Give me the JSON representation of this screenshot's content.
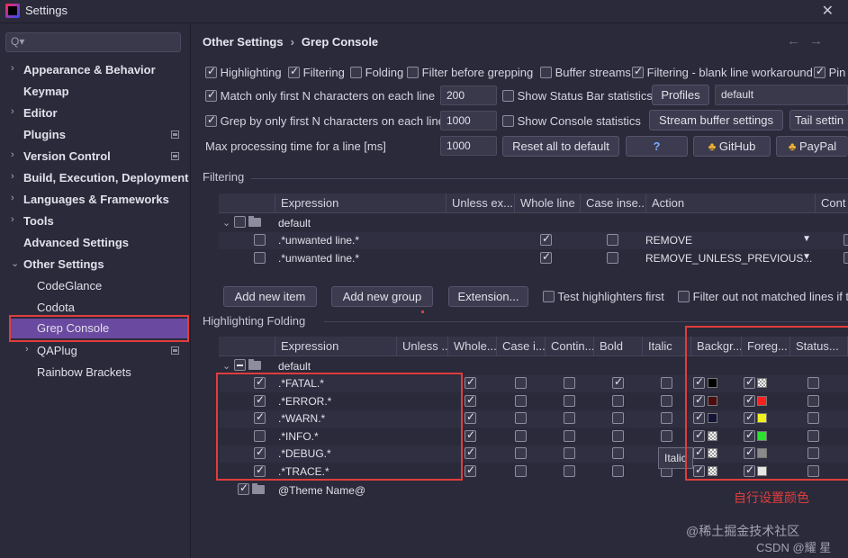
{
  "window": {
    "title": "Settings"
  },
  "sidebar": {
    "search_placeholder": "Q▾",
    "items": [
      {
        "label": "Appearance & Behavior"
      },
      {
        "label": "Keymap"
      },
      {
        "label": "Editor"
      },
      {
        "label": "Plugins"
      },
      {
        "label": "Version Control"
      },
      {
        "label": "Build, Execution, Deployment"
      },
      {
        "label": "Languages & Frameworks"
      },
      {
        "label": "Tools"
      },
      {
        "label": "Advanced Settings"
      },
      {
        "label": "Other Settings"
      },
      {
        "label": "CodeGlance"
      },
      {
        "label": "Codota"
      },
      {
        "label": "Grep Console"
      },
      {
        "label": "QAPlug"
      },
      {
        "label": "Rainbow Brackets"
      }
    ]
  },
  "breadcrumb": {
    "parent": "Other Settings",
    "sep": "›",
    "current": "Grep Console"
  },
  "options": {
    "row1": [
      "Highlighting",
      "Filtering",
      "Folding",
      "Filter before grepping",
      "Buffer streams",
      "Filtering - blank line workaround",
      "Pin"
    ],
    "match_first_n": "Match only first N characters on each line",
    "match_first_n_value": "200",
    "show_status_bar": "Show Status Bar statistics",
    "profiles_label": "Profiles",
    "profile_value": "default",
    "grep_first_n": "Grep by only first N characters on each line",
    "grep_first_n_value": "1000",
    "show_console_stats": "Show Console statistics",
    "stream_buffer": "Stream buffer settings",
    "tail_settings": "Tail settin",
    "max_processing": "Max processing time for a line [ms]",
    "max_processing_value": "1000",
    "reset_all": "Reset all to default",
    "help": "?",
    "github": "GitHub",
    "paypal": "PayPal"
  },
  "filtering": {
    "section_title": "Filtering",
    "columns": [
      "Expression",
      "Unless ex...",
      "Whole line",
      "Case inse...",
      "Action",
      "Cont"
    ],
    "group": "default",
    "rows": [
      {
        "expression": ".*unwanted line.*",
        "action": "REMOVE"
      },
      {
        "expression": ".*unwanted line.*",
        "action": "REMOVE_UNLESS_PREVIOUS..."
      }
    ],
    "buttons": [
      "Add new item",
      "Add new group",
      "Extension..."
    ],
    "test_highlighters": "Test highlighters first",
    "filter_out": "Filter out not matched lines if t"
  },
  "highlighting": {
    "section_title": "Highlighting  Folding",
    "columns": [
      "Expression",
      "Unless ...",
      "Whole...",
      "Case i...",
      "Contin...",
      "Bold",
      "Italic",
      "Backgr...",
      "Foreg...",
      "Status..."
    ],
    "group": "default",
    "rows": [
      {
        "expression": ".*FATAL.*"
      },
      {
        "expression": ".*ERROR.*"
      },
      {
        "expression": ".*WARN.*"
      },
      {
        "expression": ".*INFO.*"
      },
      {
        "expression": ".*DEBUG.*"
      },
      {
        "expression": ".*TRACE.*"
      }
    ],
    "theme_group": "@Theme Name@",
    "tooltip": "Italic",
    "colors": {
      "bg": [
        "#000000",
        "#4a0e0e",
        "#141438",
        "checker",
        "checker",
        "checker"
      ],
      "fg": [
        "checker",
        "#ff2020",
        "#f0f020",
        "#30e030",
        "#8a8a8a",
        "#e6e6e6"
      ]
    }
  },
  "annotation": "自行设置颜色",
  "watermark": {
    "line1": "@稀土掘金技术社区",
    "line2": "CSDN @耀 星"
  },
  "accent": {
    "selection": "#6a4aa0",
    "highlight_box": "#e03d3d"
  }
}
